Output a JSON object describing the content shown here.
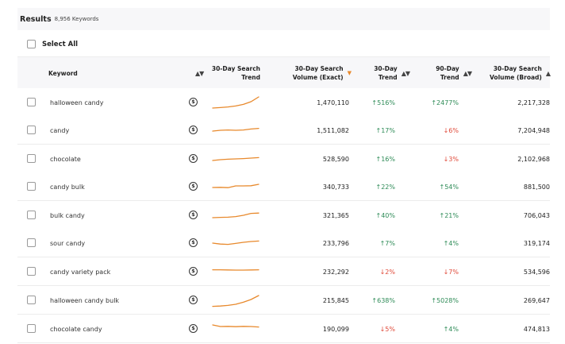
{
  "results": {
    "title": "Results",
    "count": "8,956 Keywords"
  },
  "select_all": {
    "label": "Select All"
  },
  "columns": {
    "keyword": "Keyword",
    "search_trend": [
      "30-Day Search",
      "Trend"
    ],
    "volume_exact": [
      "30-Day Search",
      "Volume (Exact)"
    ],
    "trend_30": [
      "30-Day",
      "Trend"
    ],
    "trend_90": [
      "90-Day",
      "Trend"
    ],
    "volume_broad": [
      "30-Day Search",
      "Volume (Broad)"
    ]
  },
  "icons": {
    "sort": "sort-arrows-icon",
    "sort_active": "sort-desc-icon",
    "coin": "coin-icon",
    "up": "arrow-up-icon",
    "down": "arrow-down-icon"
  },
  "colors": {
    "spark": "#e8892c",
    "up": "#2e8b57",
    "down": "#e04a3a"
  },
  "rows": [
    {
      "keyword": "halloween candy",
      "exact": "1,470,110",
      "t30": "516%",
      "t30_dir": "up",
      "t90": "2477%",
      "t90_dir": "up",
      "broad": "2,217,328",
      "spark": [
        0.15,
        0.18,
        0.22,
        0.28,
        0.38,
        0.55,
        0.85
      ]
    },
    {
      "keyword": "candy",
      "exact": "1,511,082",
      "t30": "17%",
      "t30_dir": "up",
      "t90": "6%",
      "t90_dir": "down",
      "broad": "7,204,948",
      "spark": [
        0.45,
        0.5,
        0.52,
        0.5,
        0.52,
        0.58,
        0.62
      ]
    },
    {
      "keyword": "chocolate",
      "exact": "528,590",
      "t30": "16%",
      "t30_dir": "up",
      "t90": "3%",
      "t90_dir": "down",
      "broad": "2,102,968",
      "spark": [
        0.4,
        0.45,
        0.48,
        0.5,
        0.52,
        0.55,
        0.58
      ]
    },
    {
      "keyword": "candy bulk",
      "exact": "340,733",
      "t30": "22%",
      "t30_dir": "up",
      "t90": "54%",
      "t90_dir": "up",
      "broad": "881,500",
      "spark": [
        0.45,
        0.46,
        0.44,
        0.55,
        0.55,
        0.56,
        0.65
      ]
    },
    {
      "keyword": "bulk candy",
      "exact": "321,365",
      "t30": "40%",
      "t30_dir": "up",
      "t90": "21%",
      "t90_dir": "up",
      "broad": "706,043",
      "spark": [
        0.35,
        0.37,
        0.38,
        0.42,
        0.5,
        0.62,
        0.64
      ]
    },
    {
      "keyword": "sour candy",
      "exact": "233,796",
      "t30": "7%",
      "t30_dir": "up",
      "t90": "4%",
      "t90_dir": "up",
      "broad": "319,174",
      "spark": [
        0.5,
        0.44,
        0.42,
        0.48,
        0.55,
        0.6,
        0.63
      ]
    },
    {
      "keyword": "candy variety pack",
      "exact": "232,292",
      "t30": "2%",
      "t30_dir": "down",
      "t90": "7%",
      "t90_dir": "down",
      "broad": "534,596",
      "spark": [
        0.62,
        0.62,
        0.61,
        0.6,
        0.6,
        0.61,
        0.62
      ]
    },
    {
      "keyword": "halloween candy bulk",
      "exact": "215,845",
      "t30": "638%",
      "t30_dir": "up",
      "t90": "5028%",
      "t90_dir": "up",
      "broad": "269,647",
      "spark": [
        0.12,
        0.14,
        0.18,
        0.25,
        0.38,
        0.55,
        0.8
      ]
    },
    {
      "keyword": "chocolate candy",
      "exact": "190,099",
      "t30": "5%",
      "t30_dir": "down",
      "t90": "4%",
      "t90_dir": "up",
      "broad": "474,813",
      "spark": [
        0.75,
        0.65,
        0.66,
        0.64,
        0.66,
        0.65,
        0.62
      ]
    }
  ]
}
